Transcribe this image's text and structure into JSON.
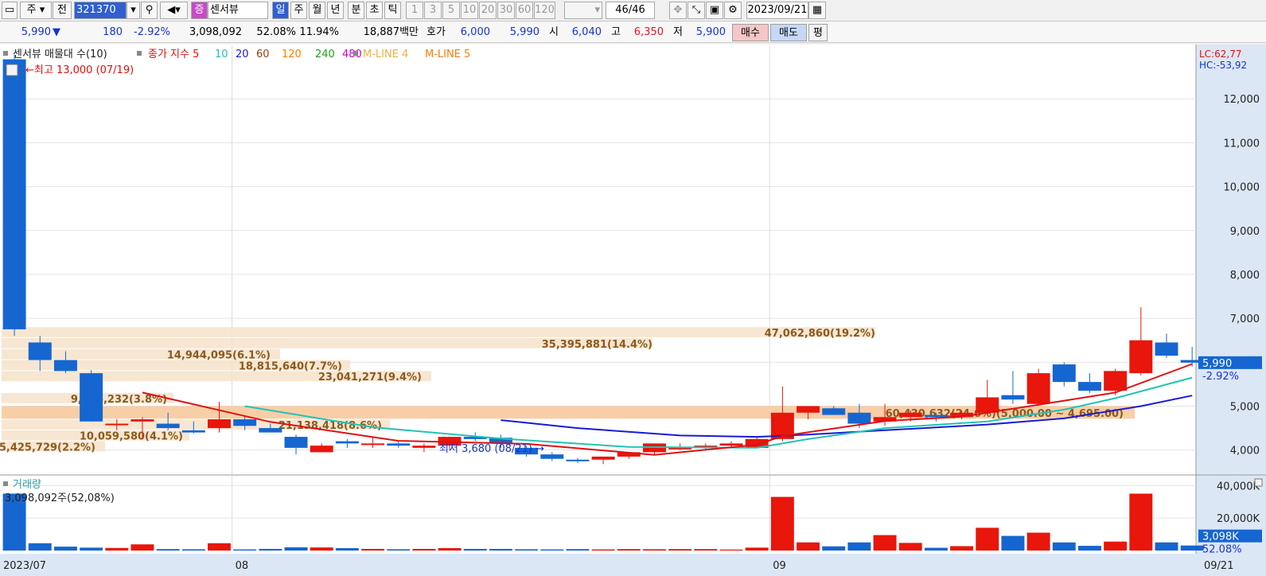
{
  "toolbar": {
    "period_label": "주",
    "prev_label": "전",
    "code": "321370",
    "name_badge": "증",
    "stock_name": "센서뷰",
    "tabs": [
      "일",
      "주",
      "월",
      "년",
      "분",
      "초",
      "틱"
    ],
    "intervals": [
      "1",
      "3",
      "5",
      "10",
      "20",
      "30",
      "60",
      "120"
    ],
    "count": "46",
    "count_total": "/46",
    "date": "2023/09/21"
  },
  "status": {
    "price": "5,990",
    "arrow": "▼",
    "change": "180",
    "change_pct": "-2.92%",
    "volume": "3,098,092",
    "vol_ratio": "52.08%",
    "turnover": "11.94%",
    "amount": "18,887백만",
    "quote_label": "호가",
    "ask": "6,000",
    "bid": "5,990",
    "open_label": "시",
    "open": "6,040",
    "high_label": "고",
    "high": "6,350",
    "low_label": "저",
    "low": "5,900",
    "buy": "매수",
    "sell": "매도",
    "eval": "평"
  },
  "legend": {
    "sensor_label": "센서뷰 매물대 수(10)",
    "close_label": "종가 지수 5",
    "ma": [
      "10",
      "20",
      "60",
      "120",
      "240",
      "480"
    ],
    "mline4": "M-LINE 4",
    "mline5": "M-LINE 5"
  },
  "annotations": {
    "high": "←최고 13,000 (07/19)",
    "low": "최저 3,680 (08/21) →",
    "lc": "LC:62,77",
    "hc": "HC:-53,92",
    "price_tag": "5,990",
    "pct_tag": "-2.92%"
  },
  "volume_panel": {
    "title": "거래량",
    "info": "3,098,092주(52,08%)",
    "vol_tag": "3,098K",
    "ratio_tag": "52.08%"
  },
  "colors": {
    "up": "#e8160b",
    "down": "#1566d1",
    "ma5": "#e01010",
    "ma10": "#22c3b6",
    "ma20": "#1a1ad6",
    "profile": "#f6e3cc",
    "profile_hot": "#f7c99d",
    "profile_text": "#8a5a1e"
  },
  "chart_data": {
    "type": "candlestick",
    "price_axis": {
      "ticks": [
        "12,000",
        "11,000",
        "10,000",
        "9,000",
        "8,000",
        "7,000",
        "6,000",
        "5,000",
        "4,000"
      ],
      "values": [
        12000,
        11000,
        10000,
        9000,
        8000,
        7000,
        6000,
        5000,
        4000
      ],
      "range": [
        3450,
        13200
      ]
    },
    "volume_axis": {
      "ticks": [
        "40,000K",
        "20,000K"
      ],
      "values": [
        40000,
        20000
      ]
    },
    "date_labels": [
      "2023/07",
      "08",
      "09",
      "09/21"
    ],
    "candles": [
      [
        12900,
        13000,
        6600,
        6750,
        35000
      ],
      [
        6450,
        6600,
        5800,
        6050,
        4500
      ],
      [
        6050,
        6250,
        5750,
        5800,
        2400
      ],
      [
        5750,
        5820,
        4650,
        4650,
        1800
      ],
      [
        4580,
        4700,
        4450,
        4600,
        1600
      ],
      [
        4650,
        4750,
        4250,
        4700,
        3800
      ],
      [
        4600,
        4850,
        4450,
        4500,
        900
      ],
      [
        4450,
        4650,
        4380,
        4400,
        800
      ],
      [
        4500,
        5100,
        4400,
        4700,
        4500
      ],
      [
        4700,
        4780,
        4450,
        4550,
        700
      ],
      [
        4500,
        4600,
        4400,
        4400,
        1000
      ],
      [
        4300,
        4350,
        3900,
        4050,
        2000
      ],
      [
        3950,
        4150,
        3950,
        4100,
        1900
      ],
      [
        4200,
        4250,
        4050,
        4150,
        1500
      ],
      [
        4150,
        4300,
        4050,
        4150,
        1000
      ],
      [
        4150,
        4200,
        4050,
        4100,
        800
      ],
      [
        4050,
        4150,
        3950,
        4100,
        1000
      ],
      [
        4100,
        4300,
        4000,
        4300,
        1500
      ],
      [
        4300,
        4400,
        4200,
        4250,
        1000
      ],
      [
        4280,
        4350,
        4050,
        4150,
        1000
      ],
      [
        4050,
        4100,
        3850,
        3900,
        800
      ],
      [
        3900,
        3950,
        3750,
        3800,
        700
      ],
      [
        3780,
        3820,
        3700,
        3760,
        900
      ],
      [
        3780,
        3850,
        3680,
        3850,
        700
      ],
      [
        3850,
        3950,
        3800,
        3950,
        900
      ],
      [
        3950,
        4150,
        3900,
        4150,
        800
      ],
      [
        4050,
        4150,
        4000,
        4050,
        900
      ],
      [
        4050,
        4150,
        4000,
        4100,
        900
      ],
      [
        4100,
        4200,
        4050,
        4150,
        600
      ],
      [
        4050,
        4300,
        4050,
        4250,
        1800
      ],
      [
        4250,
        5450,
        4200,
        4850,
        33000
      ],
      [
        4850,
        5000,
        4700,
        5000,
        5000
      ],
      [
        4950,
        5000,
        4800,
        4800,
        2600
      ],
      [
        4850,
        5050,
        4500,
        4600,
        5000
      ],
      [
        4650,
        5050,
        4550,
        4750,
        9500
      ],
      [
        4750,
        4900,
        4650,
        4850,
        4700
      ],
      [
        4800,
        4850,
        4650,
        4750,
        1700
      ],
      [
        4750,
        4900,
        4700,
        4850,
        2700
      ],
      [
        4850,
        5600,
        4800,
        5200,
        14000
      ],
      [
        5250,
        5800,
        5050,
        5150,
        9000
      ],
      [
        5050,
        5850,
        5000,
        5750,
        11000
      ],
      [
        5950,
        6000,
        5450,
        5550,
        5000
      ],
      [
        5550,
        5750,
        5300,
        5350,
        2900
      ],
      [
        5350,
        5850,
        5250,
        5800,
        5500
      ],
      [
        5750,
        7250,
        5700,
        6500,
        35000
      ],
      [
        6450,
        6650,
        6100,
        6150,
        5000
      ],
      [
        6050,
        6350,
        5900,
        5990,
        3098
      ]
    ],
    "ma5": [
      [
        5,
        5310
      ],
      [
        10,
        4640
      ],
      [
        15,
        4210
      ],
      [
        20,
        4140
      ],
      [
        25,
        3890
      ],
      [
        29,
        4120
      ],
      [
        30,
        4320
      ],
      [
        34,
        4660
      ],
      [
        37,
        4760
      ],
      [
        40,
        5030
      ],
      [
        43,
        5310
      ],
      [
        46,
        5960
      ]
    ],
    "ma10": [
      [
        9,
        5000
      ],
      [
        14,
        4520
      ],
      [
        19,
        4260
      ],
      [
        24,
        4070
      ],
      [
        29,
        4050
      ],
      [
        31,
        4250
      ],
      [
        34,
        4500
      ],
      [
        38,
        4650
      ],
      [
        41,
        4920
      ],
      [
        43,
        5180
      ],
      [
        46,
        5650
      ]
    ],
    "ma20": [
      [
        19,
        4680
      ],
      [
        22,
        4500
      ],
      [
        26,
        4330
      ],
      [
        29,
        4300
      ],
      [
        31,
        4350
      ],
      [
        34,
        4450
      ],
      [
        38,
        4580
      ],
      [
        41,
        4720
      ],
      [
        44,
        5000
      ],
      [
        46,
        5240
      ]
    ],
    "volume_profile": [
      {
        "low": 6550,
        "high": 6800,
        "label": "47,062,860(19.2%)"
      },
      {
        "low": 6300,
        "high": 6550,
        "label": "35,395,881(14.4%)"
      },
      {
        "low": 6050,
        "high": 6300,
        "label": "14,944,095(6.1%)"
      },
      {
        "low": 5800,
        "high": 6050,
        "label": "18,815,640(7.7%)"
      },
      {
        "low": 5550,
        "high": 5800,
        "label": "23,041,271(9.4%)"
      },
      {
        "low": 5050,
        "high": 5300,
        "label": "9,346,232(3.8%)"
      },
      {
        "low": 4695,
        "high": 5000,
        "label": "60,430,632(24.6%)(5,000.00 ~ 4,695.00)"
      },
      {
        "low": 4450,
        "high": 4695,
        "label": "21,138,418(8.6%)"
      },
      {
        "low": 4200,
        "high": 4450,
        "label": "10,059,580(4.1%)"
      },
      {
        "low": 3950,
        "high": 4200,
        "label": "5,425,729(2.2%)"
      }
    ]
  }
}
